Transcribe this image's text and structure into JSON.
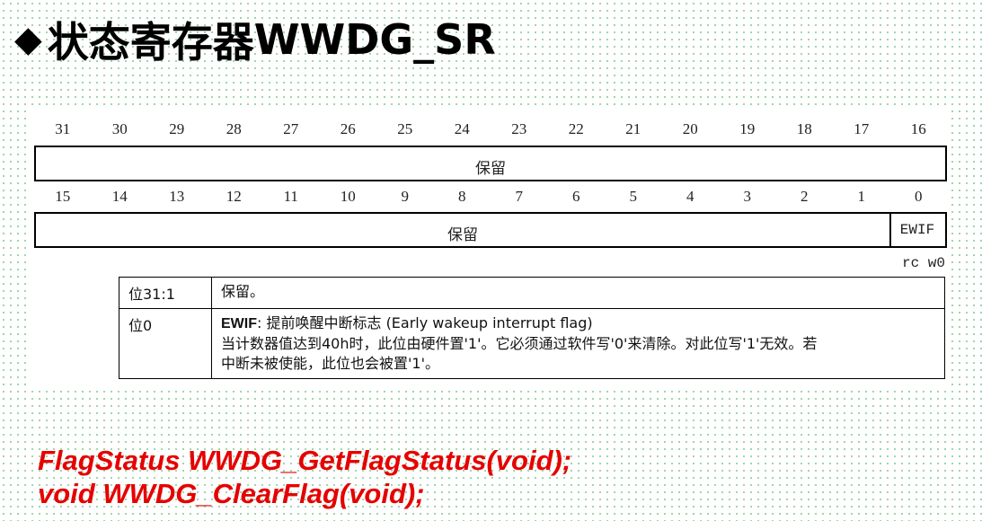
{
  "slide": {
    "title_diamond": "◆",
    "title_cn": "状态寄存器",
    "title_reg": "WWDG_SR"
  },
  "register": {
    "high_bits": [
      "31",
      "30",
      "29",
      "28",
      "27",
      "26",
      "25",
      "24",
      "23",
      "22",
      "21",
      "20",
      "19",
      "18",
      "17",
      "16"
    ],
    "low_bits": [
      "15",
      "14",
      "13",
      "12",
      "11",
      "10",
      "9",
      "8",
      "7",
      "6",
      "5",
      "4",
      "3",
      "2",
      "1",
      "0"
    ],
    "high_field": "保留",
    "low_reserved_field": "保留",
    "bit0_field": "EWIF",
    "bit0_access": "rc w0"
  },
  "description": {
    "rows": [
      {
        "bits": "位31:1",
        "text": "保留。"
      },
      {
        "bits": "位0",
        "name": "EWIF",
        "title_rest": ": 提前唤醒中断标志 (Early wakeup interrupt flag)",
        "line1": "当计数器值达到40h时，此位由硬件置'1'。它必须通过软件写'0'来清除。对此位写'1'无效。若",
        "line2": "中断未被使能，此位也会被置'1'。"
      }
    ]
  },
  "code": {
    "line1": "FlagStatus WWDG_GetFlagStatus(void);",
    "line2": "void WWDG_ClearFlag(void);"
  },
  "colors": {
    "code": "#e60000",
    "dots": "#8fcf9f"
  }
}
